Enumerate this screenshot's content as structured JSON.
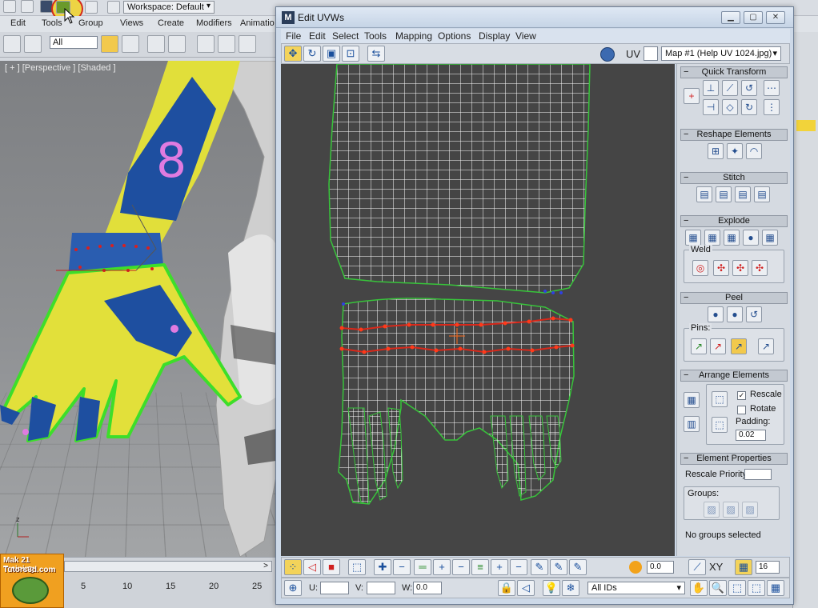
{
  "host": {
    "workspace": "Workspace: Default",
    "menu": [
      "Edit",
      "Tools",
      "Group",
      "Views",
      "Create",
      "Modifiers",
      "Animatio"
    ],
    "selection_filter": "All",
    "viewport_label": "[ + ] [Perspective ] [Shaded ]",
    "timeline_ticks": [
      "5",
      "10",
      "15",
      "20",
      "25"
    ],
    "logo_line1": "Mak 21 Training",
    "logo_line2": "Tutors3d.com"
  },
  "uvw": {
    "title": "Edit UVWs",
    "menu": [
      "File",
      "Edit",
      "Select",
      "Tools",
      "Mapping",
      "Options",
      "Display",
      "View"
    ],
    "uv_label": "UV",
    "map_select": "Map #1 (Help UV 1024.jpg)",
    "rollouts": {
      "quick_transform": "Quick Transform",
      "reshape_elements": "Reshape Elements",
      "stitch": "Stitch",
      "explode": "Explode",
      "weld": "Weld",
      "peel": "Peel",
      "pins": "Pins:",
      "arrange_elements": "Arrange Elements",
      "rescale": "Rescale",
      "rotate": "Rotate",
      "padding_label": "Padding:",
      "padding_value": "0.02",
      "element_properties": "Element Properties",
      "rescale_priority": "Rescale Priority:",
      "groups": "Groups:",
      "no_groups": "No groups selected"
    },
    "bottom": {
      "angle_value": "0.0",
      "xy_label": "XY",
      "grid_value": "16",
      "u_label": "U:",
      "v_label": "V:",
      "w_label": "W:",
      "w_value": "0.0",
      "ids_select": "All IDs"
    }
  }
}
